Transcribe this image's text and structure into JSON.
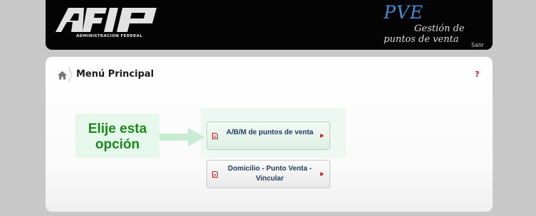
{
  "header": {
    "logo_text": "AFIP",
    "logo_subtitle": "ADMINISTRACION FEDERAL",
    "app_title": "PVE",
    "app_subtitle_line1": "Gestión de",
    "app_subtitle_line2": "puntos de venta",
    "logout_label": "Salir",
    "background_color": "#040404",
    "title_color": "#3f8fd4"
  },
  "panel": {
    "title": "Menú Principal",
    "help_label": "?",
    "home_icon": "home-icon"
  },
  "callout": {
    "line1": "Elije esta",
    "line2": "opción",
    "text_color": "#1a8a1a"
  },
  "menu": {
    "items": [
      {
        "label": "A/B/M de puntos de venta",
        "icon": "document-icon",
        "highlighted": true
      },
      {
        "label": "Domicilio - Punto Venta - Vincular",
        "icon": "document-icon",
        "highlighted": false
      }
    ]
  }
}
